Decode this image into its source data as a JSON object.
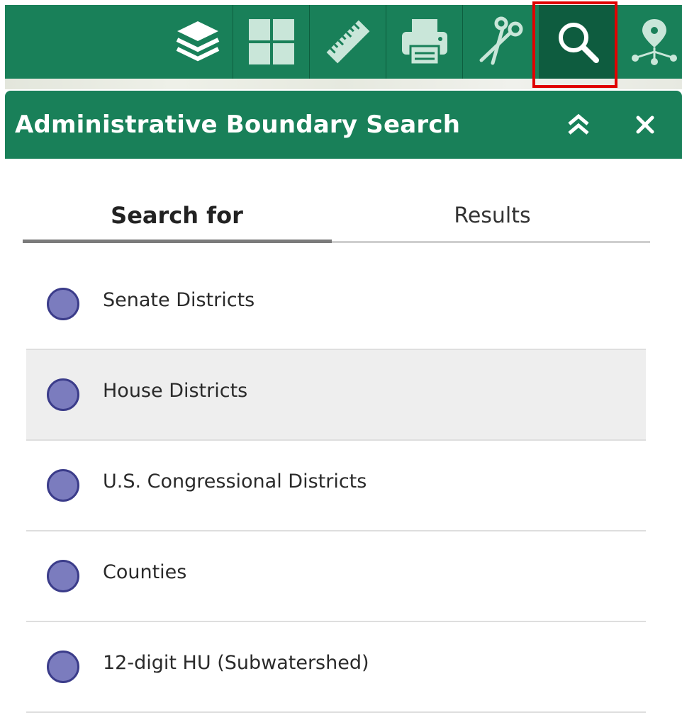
{
  "toolbar": {
    "tools": [
      {
        "icon": "layers-icon"
      },
      {
        "icon": "basemap-gallery-icon"
      },
      {
        "icon": "measure-ruler-icon"
      },
      {
        "icon": "print-icon"
      },
      {
        "icon": "scissors-icon"
      },
      {
        "icon": "search-icon",
        "active": true
      },
      {
        "icon": "network-pin-icon"
      }
    ],
    "highlight_color": "#e00000"
  },
  "panel": {
    "title": "Administrative Boundary Search",
    "collapse_icon": "double-chevron-up-icon",
    "close_icon": "close-icon"
  },
  "tabs": {
    "search_for": "Search for",
    "results": "Results",
    "active": "search_for"
  },
  "items": [
    {
      "label": "Senate Districts"
    },
    {
      "label": "House Districts",
      "hover": true
    },
    {
      "label": "U.S. Congressional Districts"
    },
    {
      "label": "Counties"
    },
    {
      "label": "12-digit HU (Subwatershed)"
    }
  ],
  "colors": {
    "header_green": "#198059",
    "active_tool": "#0e5c3f",
    "dot_fill": "#7b7cbe",
    "dot_stroke": "#3b3c8a"
  }
}
